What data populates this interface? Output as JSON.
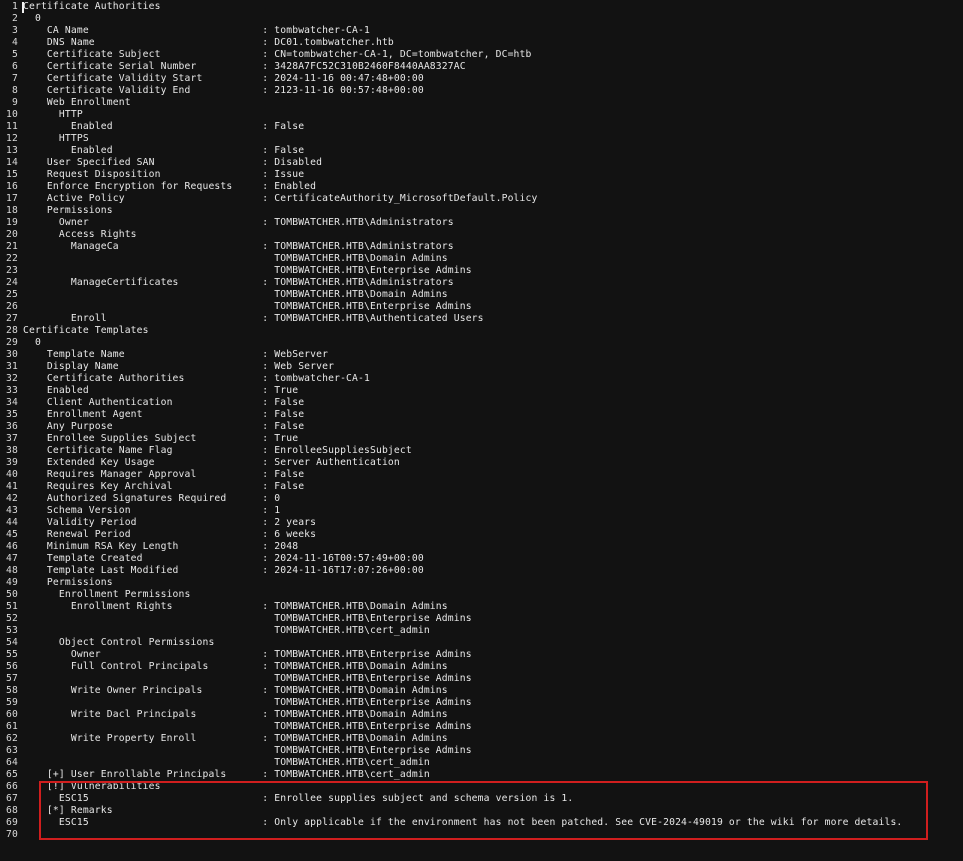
{
  "editor": {
    "lines": [
      "Certificate Authorities",
      "  0",
      "    CA Name                             : tombwatcher-CA-1",
      "    DNS Name                            : DC01.tombwatcher.htb",
      "    Certificate Subject                 : CN=tombwatcher-CA-1, DC=tombwatcher, DC=htb",
      "    Certificate Serial Number           : 3428A7FC52C310B2460F8440AA8327AC",
      "    Certificate Validity Start          : 2024-11-16 00:47:48+00:00",
      "    Certificate Validity End            : 2123-11-16 00:57:48+00:00",
      "    Web Enrollment",
      "      HTTP",
      "        Enabled                         : False",
      "      HTTPS",
      "        Enabled                         : False",
      "    User Specified SAN                  : Disabled",
      "    Request Disposition                 : Issue",
      "    Enforce Encryption for Requests     : Enabled",
      "    Active Policy                       : CertificateAuthority_MicrosoftDefault.Policy",
      "    Permissions",
      "      Owner                             : TOMBWATCHER.HTB\\Administrators",
      "      Access Rights",
      "        ManageCa                        : TOMBWATCHER.HTB\\Administrators",
      "                                          TOMBWATCHER.HTB\\Domain Admins",
      "                                          TOMBWATCHER.HTB\\Enterprise Admins",
      "        ManageCertificates              : TOMBWATCHER.HTB\\Administrators",
      "                                          TOMBWATCHER.HTB\\Domain Admins",
      "                                          TOMBWATCHER.HTB\\Enterprise Admins",
      "        Enroll                          : TOMBWATCHER.HTB\\Authenticated Users",
      "Certificate Templates",
      "  0",
      "    Template Name                       : WebServer",
      "    Display Name                        : Web Server",
      "    Certificate Authorities             : tombwatcher-CA-1",
      "    Enabled                             : True",
      "    Client Authentication               : False",
      "    Enrollment Agent                    : False",
      "    Any Purpose                         : False",
      "    Enrollee Supplies Subject           : True",
      "    Certificate Name Flag               : EnrolleeSuppliesSubject",
      "    Extended Key Usage                  : Server Authentication",
      "    Requires Manager Approval           : False",
      "    Requires Key Archival               : False",
      "    Authorized Signatures Required      : 0",
      "    Schema Version                      : 1",
      "    Validity Period                     : 2 years",
      "    Renewal Period                      : 6 weeks",
      "    Minimum RSA Key Length              : 2048",
      "    Template Created                    : 2024-11-16T00:57:49+00:00",
      "    Template Last Modified              : 2024-11-16T17:07:26+00:00",
      "    Permissions",
      "      Enrollment Permissions",
      "        Enrollment Rights               : TOMBWATCHER.HTB\\Domain Admins",
      "                                          TOMBWATCHER.HTB\\Enterprise Admins",
      "                                          TOMBWATCHER.HTB\\cert_admin",
      "      Object Control Permissions",
      "        Owner                           : TOMBWATCHER.HTB\\Enterprise Admins",
      "        Full Control Principals         : TOMBWATCHER.HTB\\Domain Admins",
      "                                          TOMBWATCHER.HTB\\Enterprise Admins",
      "        Write Owner Principals          : TOMBWATCHER.HTB\\Domain Admins",
      "                                          TOMBWATCHER.HTB\\Enterprise Admins",
      "        Write Dacl Principals           : TOMBWATCHER.HTB\\Domain Admins",
      "                                          TOMBWATCHER.HTB\\Enterprise Admins",
      "        Write Property Enroll           : TOMBWATCHER.HTB\\Domain Admins",
      "                                          TOMBWATCHER.HTB\\Enterprise Admins",
      "                                          TOMBWATCHER.HTB\\cert_admin",
      "    [+] User Enrollable Principals      : TOMBWATCHER.HTB\\cert_admin",
      "    [!] Vulnerabilities",
      "      ESC15                             : Enrollee supplies subject and schema version is 1.",
      "    [*] Remarks",
      "      ESC15                             : Only applicable if the environment has not been patched. See CVE-2024-49019 or the wiki for more details.",
      ""
    ]
  },
  "colors": {
    "background": "#121212",
    "text": "#e8e8e8",
    "highlight_border": "#d01e1e"
  }
}
